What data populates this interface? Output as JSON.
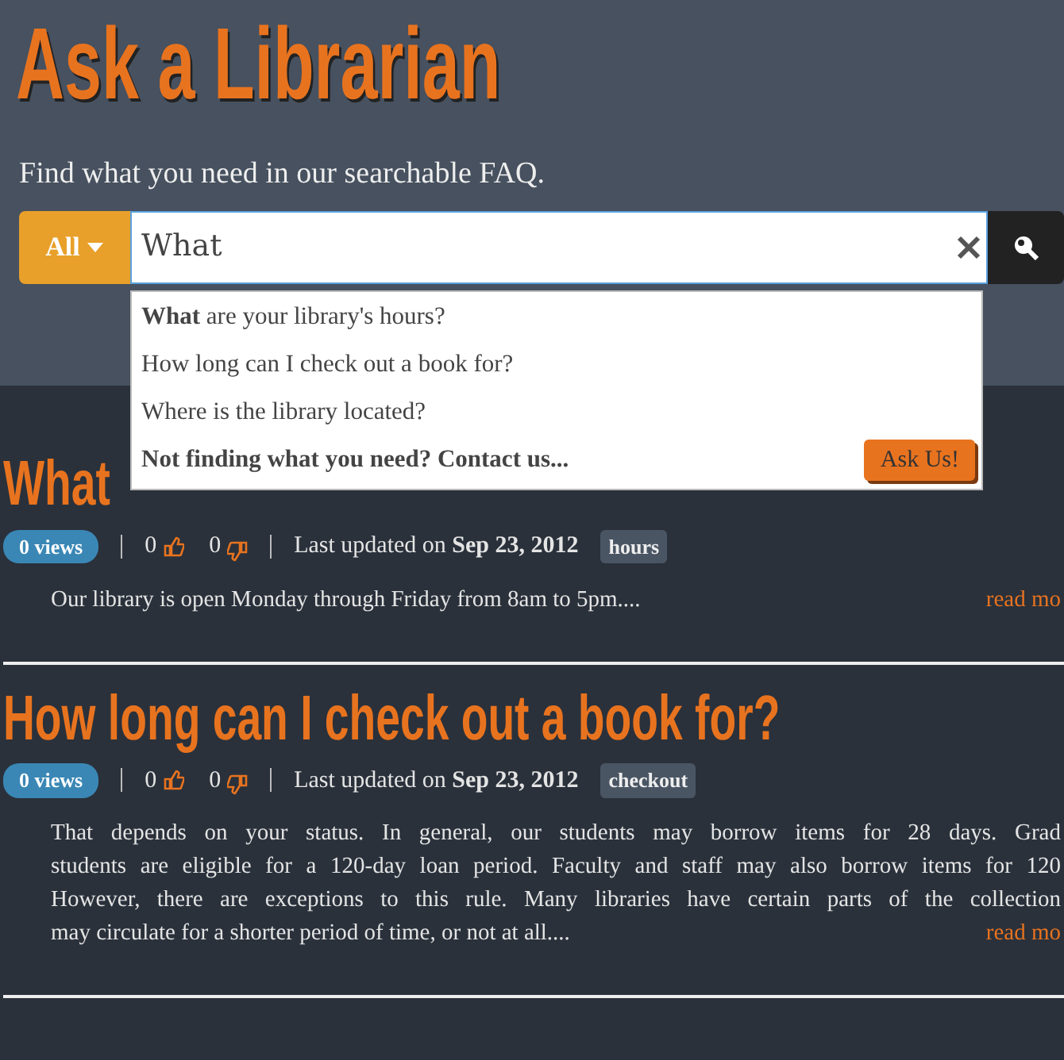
{
  "header": {
    "title": "Ask a Librarian",
    "subtitle": "Find what you need in our searchable FAQ."
  },
  "search": {
    "category": "All",
    "value": "What",
    "suggestions": [
      {
        "kind": "question",
        "text": "**What** are your library's hours?"
      },
      {
        "kind": "question",
        "text": "How long can I check out a book for?"
      },
      {
        "kind": "question",
        "text": "Where is the library located?"
      },
      {
        "kind": "contact",
        "text": "Not finding what you need? Contact us..."
      }
    ],
    "ask_button": "Ask Us!"
  },
  "articles": [
    {
      "title": "What",
      "views": "0 views",
      "up": "0",
      "down": "0",
      "updated": "Last updated on",
      "date": "Sep 23, 2012",
      "tag": "hours",
      "lines": [
        "Our library is open Monday through Friday from 8am to 5pm...."
      ],
      "read_more": "read mo"
    },
    {
      "title": "How long can I check out a book for?",
      "views": "0 views",
      "up": "0",
      "down": "0",
      "updated": "Last updated on",
      "date": "Sep 23, 2012",
      "tag": "checkout",
      "lines": [
        "That depends on your status. In general, our students may borrow items for 28 days. Grad",
        "students are eligible for a 120-day loan period. Faculty and staff may also borrow items for 120",
        "However, there are exceptions to this rule. Many libraries have certain parts of the collection",
        "may circulate for a shorter period of time, or not at all...."
      ],
      "read_more": "read mo"
    }
  ]
}
